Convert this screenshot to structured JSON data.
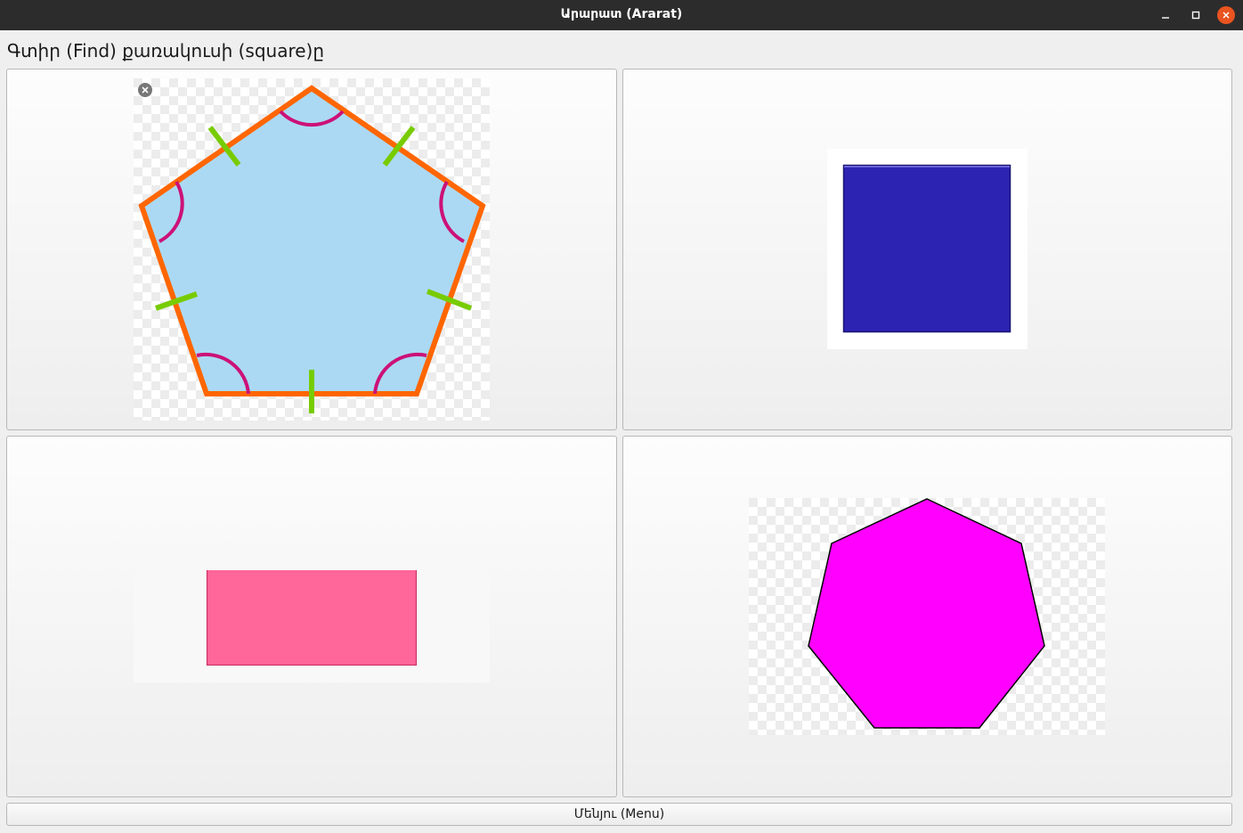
{
  "window": {
    "title": "Արարատ (Ararat)"
  },
  "prompt": "Գտիր (Find) քառակուսի (square)ը",
  "choices": [
    {
      "shape": "pentagon",
      "fill": "#abd9f4",
      "outline": "#ff6600",
      "marks": "#77cc00",
      "angle_marks": "#cc1177"
    },
    {
      "shape": "square",
      "fill": "#2d23b2",
      "outline": "#1a1575"
    },
    {
      "shape": "rectangle",
      "fill": "#ff6699",
      "outline": "#cc3366"
    },
    {
      "shape": "heptagon",
      "fill": "#ff00ff",
      "outline": "#000000"
    }
  ],
  "menu_button_label": "Մենյու (Menu)",
  "icons": [
    "minimize-icon",
    "maximize-icon",
    "close-icon",
    "remove-icon"
  ]
}
